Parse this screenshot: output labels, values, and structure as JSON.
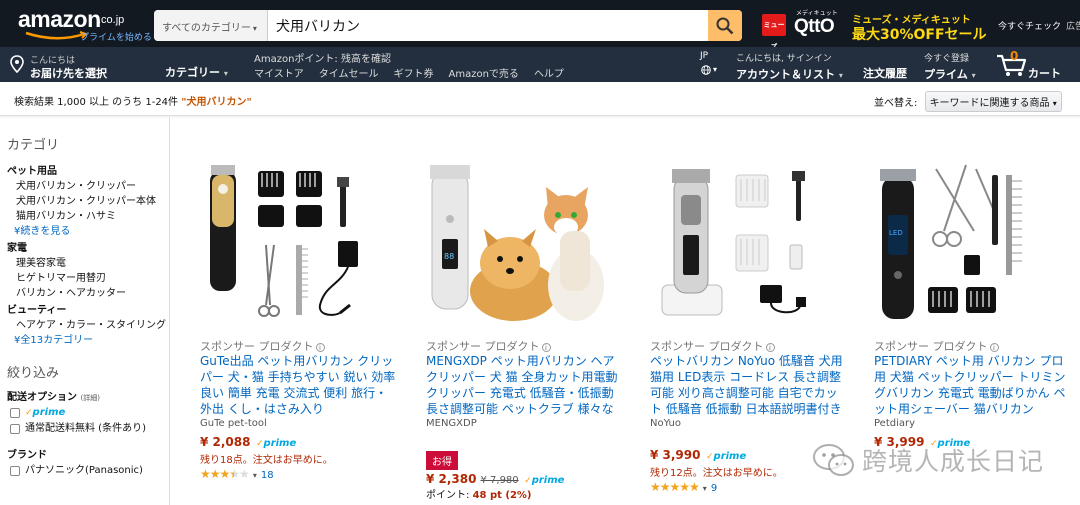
{
  "header": {
    "logo_word": "amazon",
    "logo_tld": ".co.jp",
    "prime_link": "プライムを始める",
    "search": {
      "category": "すべてのカテゴリー",
      "query": "犬用バリカン"
    },
    "promo": {
      "badge": "ミューズ",
      "qtto_sub": "メディキュット",
      "qtto": "QttO",
      "line1": "ミューズ・メディキュット",
      "line2": "最大30%OFFセール"
    },
    "quick_check": "今すぐチェック",
    "ad_label": "広告"
  },
  "nav": {
    "address_greeting": "こんにちは",
    "address_label": "お届け先を選択",
    "categories": "カテゴリー",
    "points_text": "Amazonポイント: 残高を確認",
    "links": [
      "マイストア",
      "タイムセール",
      "ギフト券",
      "Amazonで売る",
      "ヘルプ"
    ],
    "lang": "JP",
    "account_greeting": "こんにちは, サインイン",
    "account_label": "アカウント＆リスト",
    "orders": "注文履歴",
    "prime_sub": "今すぐ登録",
    "prime_label": "プライム",
    "cart_count": "0",
    "cart_label": "カート"
  },
  "results": {
    "count_text": "検索結果 1,000 以上 のうち 1-24件",
    "query_quoted": "\"犬用バリカン\"",
    "sort_label": "並べ替え:",
    "sort_value": "キーワードに関連する商品"
  },
  "sidebar": {
    "category_heading": "カテゴリ",
    "groups": [
      {
        "name": "ペット用品",
        "items": [
          "犬用バリカン・クリッパー",
          "犬用バリカン・クリッパー本体",
          "猫用バリカン・ハサミ"
        ],
        "more": "続きを見る"
      },
      {
        "name": "家電",
        "items": [
          "理美容家電",
          "ヒゲトリマー用替刃",
          "バリカン・ヘアカッター"
        ]
      },
      {
        "name": "ビューティー",
        "items": [
          "ヘアケア・カラー・スタイリング"
        ],
        "more": "全13カテゴリー"
      }
    ],
    "filter_heading": "絞り込み",
    "delivery_heading": "配送オプション",
    "delivery_detail": "(詳細)",
    "delivery_options": [
      "prime",
      "通常配送料無料 (条件あり)"
    ],
    "brand_heading": "ブランド",
    "brand_first": "パナソニック(Panasonic)"
  },
  "products": [
    {
      "sponsored": "スポンサー プロダクト",
      "title": "GuTe出品 ペット用バリカン クリッパー 犬・猫 手持ちやすい 鋭い 効率良い 簡単 充電 交流式 便利 旅行・外出 くし・はさみ入り",
      "brand": "GuTe pet-tool",
      "price": "¥ 2,088",
      "prime": "prime",
      "stock": "残り18点。注文はお早めに。",
      "rating": 3.5,
      "reviews": "18"
    },
    {
      "sponsored": "スポンサー プロダクト",
      "title": "MENGXDP ペット用バリカン ヘアクリッパー 犬 猫 全身カット用電動クリッパー 充電式 低騒音・低振動 長さ調整可能 ペットクラブ 様々な犬種に適用",
      "brand": "MENGXDP",
      "deal": "お得",
      "price": "¥ 2,380",
      "list_price": "¥ 7,980",
      "prime": "prime",
      "points_label": "ポイント:",
      "points_value": "48 pt (2%)"
    },
    {
      "sponsored": "スポンサー プロダクト",
      "title": "ペットバリカン NoYuo 低騒音 犬用 猫用 LED表示 コードレス 長さ調整可能 刈り高さ調整可能 自宅でカット 低騒音 低振動 日本語説明書付き",
      "brand": "NoYuo",
      "price": "¥ 3,990",
      "prime": "prime",
      "stock": "残り12点。注文はお早めに。",
      "rating": 5,
      "reviews": "9"
    },
    {
      "sponsored": "スポンサー プロダクト",
      "title": "PETDIARY ペット用 バリカン プロ用 犬猫 ペットクリッパー トリミングバリカン 充電式 電動ばりかん ペット用シェーバー 猫バリカン",
      "brand": "Petdiary",
      "price": "¥ 3,999",
      "prime": "prime"
    }
  ],
  "watermark": "跨境人成长日记",
  "colors": {
    "header_bg": "#131921",
    "nav_bg": "#232f3e",
    "search_button": "#febd69",
    "link": "#0066c0",
    "price": "#b12704",
    "prime_blue": "#00a8e1",
    "star": "#f4a41c",
    "deal_red": "#cc0c39"
  }
}
